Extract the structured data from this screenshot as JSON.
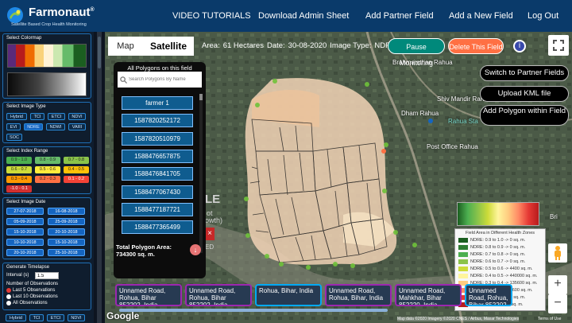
{
  "brand": {
    "name": "Farmonaut",
    "trademark": "®",
    "tagline": "Satellite Based Crop Health Monitoring"
  },
  "nav": {
    "items": [
      "VIDEO TUTORIALS",
      "Download Admin Sheet",
      "Add Partner Field",
      "Add a New Field",
      "Log Out"
    ]
  },
  "sidebar": {
    "colormap_label": "Select Colormap",
    "image_type_label": "Select Image Type",
    "image_types": [
      "Hybrid",
      "TCI",
      "ETCI",
      "NDVI",
      "EVI",
      "NDRE",
      "NDWI",
      "VARI",
      "SOC"
    ],
    "index_range_label": "Select Index Range",
    "ranges": [
      {
        "label": "0.9 - 1.0",
        "color": "#4caf50"
      },
      {
        "label": "0.8 - 0.9",
        "color": "#66bb6a"
      },
      {
        "label": "0.7 - 0.8",
        "color": "#8bc34a"
      },
      {
        "label": "0.6 - 0.7",
        "color": "#cddc39"
      },
      {
        "label": "0.5 - 0.6",
        "color": "#ffeb3b"
      },
      {
        "label": "0.4 - 0.5",
        "color": "#ffc107"
      },
      {
        "label": "0.3 - 0.4",
        "color": "#ff9800"
      },
      {
        "label": "0.2 - 0.3",
        "color": "#ff7043"
      },
      {
        "label": "0.1 - 0.2",
        "color": "#f44336"
      },
      {
        "label": "-1.0 - 0.1",
        "color": "#d32f2f"
      }
    ],
    "image_date_label": "Select Image Date",
    "dates": [
      "27-07-2018",
      "16-08-2018",
      "05-09-2018",
      "25-09-2018",
      "15-10-2018",
      "20-10-2018",
      "10-10-2018",
      "15-10-2018",
      "20-10-2018",
      "25-10-2018"
    ],
    "timelapse_label": "Generate Timelapse",
    "interval_label": "Interval (s)",
    "interval_value": "1.5",
    "observations_label": "Number of Observations",
    "observations": [
      "Last 5 Observations",
      "Last 10 Observations",
      "All Observations"
    ],
    "bottom_types": [
      "Hybrid",
      "TCI",
      "ETCI",
      "NDVI"
    ]
  },
  "map": {
    "tabs": {
      "map": "Map",
      "satellite": "Satellite"
    },
    "info": {
      "area_label": "Area:",
      "area_value": "61 Hectares",
      "date_label": "Date:",
      "date_value": "30-08-2020",
      "type_label": "Image Type:",
      "type_value": "NDRE"
    },
    "pause_button": "Pause Monitoring",
    "delete_button": "Delete This Field",
    "right_buttons": [
      "Switch to Partner Fields",
      "Upload KML file",
      "Add Polygon within Field"
    ],
    "place_labels": [
      "Brahma sthan Rahua",
      "Shiv Mandir Rahua",
      "Dham Rahua",
      "Rahua Sta",
      "Post Office Rahua",
      "Bri"
    ],
    "google": "Google",
    "attribution": "Map data ©2020 Imagery ©2020 CNES / Airbus, Maxar Technologies",
    "terms": "Terms of Use",
    "overlay_text": [
      "LE",
      "ot",
      "owth)",
      "ED"
    ]
  },
  "polygons": {
    "title": "All Polygons on this field",
    "search_placeholder": "Search Polygons By Name",
    "items": [
      "farmer 1",
      "1587820252172",
      "1587820510979",
      "1588476657875",
      "1588476841705",
      "1588477067430",
      "1588477187721",
      "1588477365499"
    ],
    "total_label": "Total Polygon Area: 734300 sq. m."
  },
  "addresses": [
    {
      "text": "Unnamed Road, Rohua, Bihar 852202, India",
      "border": "#9c27b0"
    },
    {
      "text": "Unnamed Road, Rohua, Bihar 852202, India",
      "border": "#9c27b0"
    },
    {
      "text": "Rohua, Bihar, India",
      "border": "#03a9f4"
    },
    {
      "text": "Unnamed Road, Rohua, Bihar, India",
      "border": "#9c27b0"
    },
    {
      "text": "Unnamed Road, Mahkhar, Bihar 852220, India",
      "border": "#9c27b0"
    },
    {
      "text": "Unnamed Road, Rohua, Bihar 852202, India",
      "border": "#03a9f4"
    }
  ],
  "legend": {
    "title": "Field Area in Different Health Zones",
    "rows": [
      {
        "label": "NDRE: 0.9 to 1.0 -> 0 sq. m.",
        "color": "#1b5e20"
      },
      {
        "label": "NDRE: 0.8 to 0.9 -> 0 sq. m.",
        "color": "#2e7d32"
      },
      {
        "label": "NDRE: 0.7 to 0.8 -> 0 sq. m.",
        "color": "#4caf50"
      },
      {
        "label": "NDRE: 0.6 to 0.7 -> 0 sq. m.",
        "color": "#8bc34a"
      },
      {
        "label": "NDRE: 0.5 to 0.6 -> 4400 sq. m.",
        "color": "#cddc39"
      },
      {
        "label": "NDRE: 0.4 to 0.5 -> 440000 sq. m.",
        "color": "#fff59d"
      },
      {
        "label": "NDRE: 0.3 to 0.4 -> 135600 sq. m.",
        "color": "#ffcc80"
      },
      {
        "label": "NDRE: 0.2 to 0.3 -> 9600 sq. m.",
        "color": "#ff8a65"
      },
      {
        "label": "NDRE: 0.1 to 0.2 -> 0 sq. m.",
        "color": "#e53935"
      },
      {
        "label": "NDRE: -1 to 0.1 -> 0 sq. m.",
        "color": "#b71c1c"
      }
    ]
  }
}
